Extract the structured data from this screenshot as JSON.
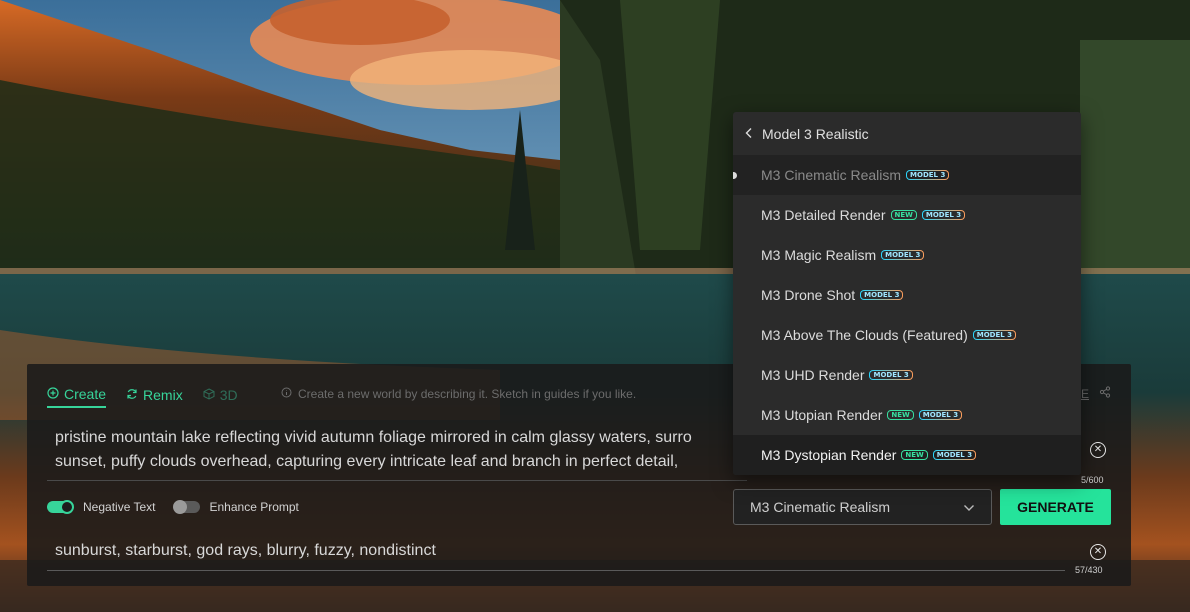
{
  "tabs": [
    {
      "label": "Create",
      "icon": "plus-circle-icon"
    },
    {
      "label": "Remix",
      "icon": "refresh-icon"
    },
    {
      "label": "3D",
      "icon": "cube-icon"
    }
  ],
  "hint": "Create a new world by describing it. Sketch in guides if you like.",
  "topright": {
    "label": "E",
    "icon": "share-icon"
  },
  "prompt": {
    "line1": "pristine mountain lake reflecting vivid autumn foliage mirrored in calm glassy waters, surro",
    "line2": "sunset, puffy clouds overhead, capturing every intricate leaf and branch in perfect detail,",
    "count": "5/600"
  },
  "toggles": [
    {
      "label": "Negative Text",
      "state": "on"
    },
    {
      "label": "Enhance Prompt",
      "state": "off"
    }
  ],
  "model_select": {
    "value": "M3 Cinematic Realism"
  },
  "generate_label": "GENERATE",
  "negative": {
    "text": "sunburst, starburst, god rays, blurry, fuzzy, nondistinct",
    "count": "57/430"
  },
  "dropdown": {
    "title": "Model 3 Realistic",
    "items": [
      {
        "label": "M3 Cinematic Realism",
        "new": false,
        "badge": "MODEL 3"
      },
      {
        "label": "M3 Detailed Render",
        "new": true,
        "badge": "MODEL 3"
      },
      {
        "label": "M3 Magic Realism",
        "new": false,
        "badge": "MODEL 3"
      },
      {
        "label": "M3 Drone Shot",
        "new": false,
        "badge": "MODEL 3"
      },
      {
        "label": "M3 Above The Clouds (Featured)",
        "new": false,
        "badge": "MODEL 3"
      },
      {
        "label": "M3 UHD Render",
        "new": false,
        "badge": "MODEL 3"
      },
      {
        "label": "M3 Utopian Render",
        "new": true,
        "badge": "MODEL 3"
      },
      {
        "label": "M3 Dystopian Render",
        "new": true,
        "badge": "MODEL 3"
      }
    ],
    "new_label": "NEW"
  },
  "colors": {
    "accent": "#37d49a",
    "generate": "#25e39b"
  }
}
